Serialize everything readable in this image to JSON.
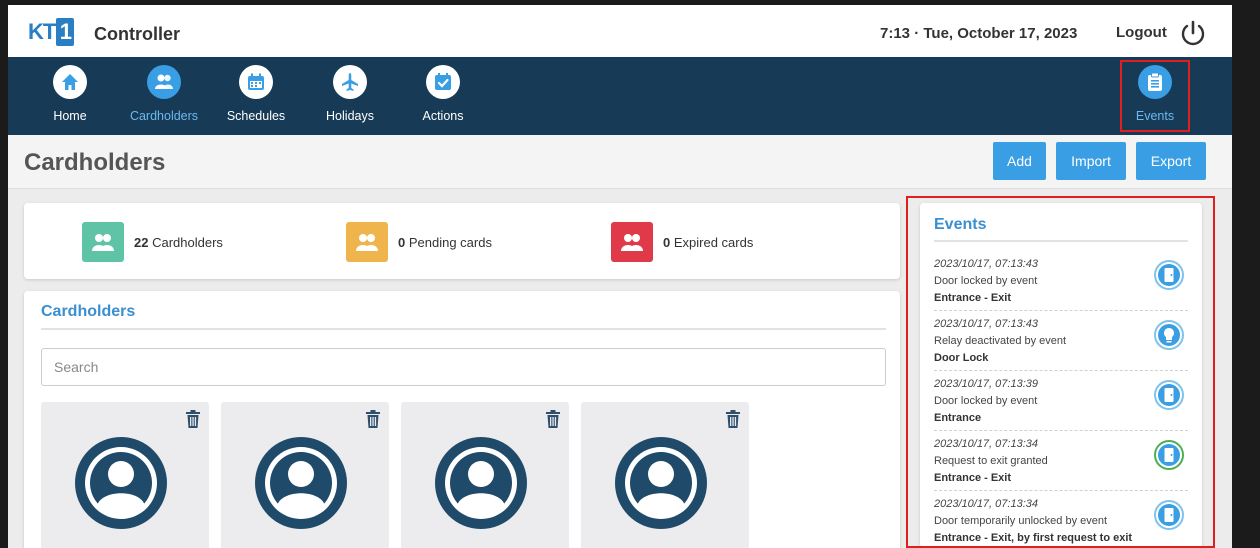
{
  "header": {
    "logo_prefix": "KT",
    "logo_digit": "1",
    "app_title": "Controller",
    "datetime": "7:13 · Tue, October 17, 2023",
    "logout_label": "Logout"
  },
  "nav": {
    "items": [
      {
        "label": "Home",
        "icon": "home-icon"
      },
      {
        "label": "Cardholders",
        "icon": "cardholders-icon"
      },
      {
        "label": "Schedules",
        "icon": "calendar-icon"
      },
      {
        "label": "Holidays",
        "icon": "airplane-icon"
      },
      {
        "label": "Actions",
        "icon": "checklist-icon"
      }
    ],
    "events_label": "Events",
    "active": "Cardholders"
  },
  "page": {
    "title": "Cardholders",
    "buttons": {
      "add": "Add",
      "import": "Import",
      "export": "Export"
    }
  },
  "summary": {
    "cardholders": {
      "count": "22",
      "label": "Cardholders",
      "color": "#5fc4a6"
    },
    "pending": {
      "count": "0",
      "label": "Pending cards",
      "color": "#f0b44c"
    },
    "expired": {
      "count": "0",
      "label": "Expired cards",
      "color": "#e0394a"
    }
  },
  "cardholders_panel": {
    "title": "Cardholders",
    "search_placeholder": "Search",
    "cards": [
      {
        "avatar": "user-avatar-icon"
      },
      {
        "avatar": "user-avatar-icon"
      },
      {
        "avatar": "user-avatar-icon"
      },
      {
        "avatar": "user-avatar-icon"
      }
    ]
  },
  "events_panel": {
    "title": "Events",
    "events": [
      {
        "time": "2023/10/17, 07:13:43",
        "desc": "Door locked by event",
        "location": "Entrance - Exit",
        "icon": "door-icon"
      },
      {
        "time": "2023/10/17, 07:13:43",
        "desc": "Relay deactivated by event",
        "location": "Door Lock",
        "icon": "relay-icon"
      },
      {
        "time": "2023/10/17, 07:13:39",
        "desc": "Door locked by event",
        "location": "Entrance",
        "icon": "door-icon"
      },
      {
        "time": "2023/10/17, 07:13:34",
        "desc": "Request to exit granted",
        "location": "Entrance - Exit",
        "icon": "exit-granted-icon"
      },
      {
        "time": "2023/10/17, 07:13:34",
        "desc": "Door temporarily unlocked by event",
        "location": "Entrance - Exit, by first request to exit",
        "icon": "door-icon"
      }
    ]
  },
  "colors": {
    "nav_bg": "#173a56",
    "accent": "#3a9ee4",
    "highlight": "#e02020",
    "avatar": "#1f4a6a",
    "granted": "#4caf50"
  }
}
